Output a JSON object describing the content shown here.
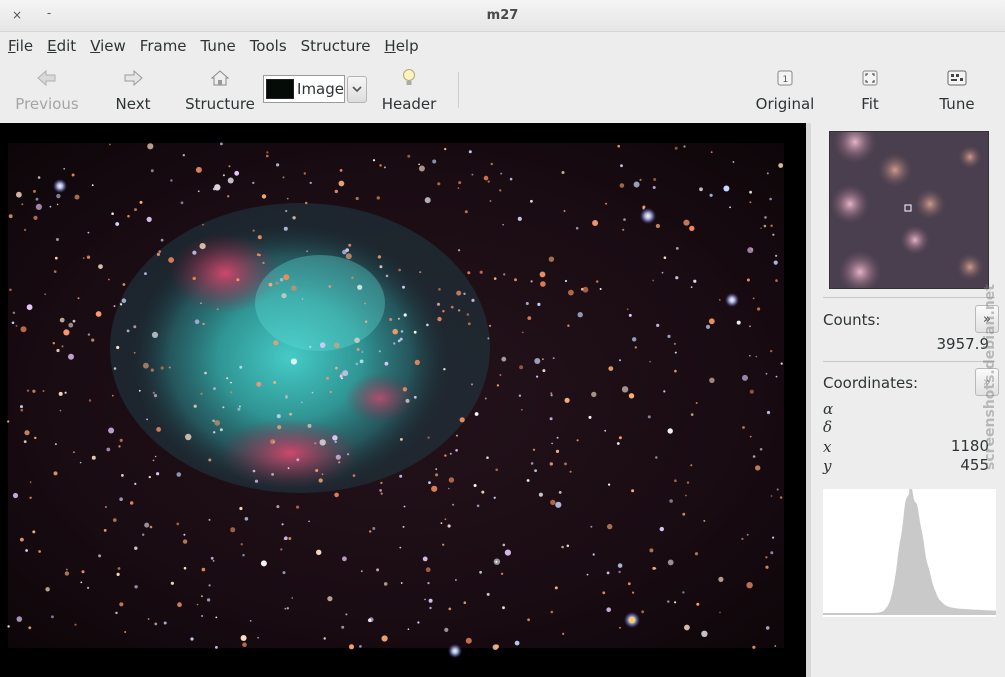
{
  "window": {
    "title": "m27",
    "close_glyph": "×",
    "minimize_glyph": "-"
  },
  "menu": [
    {
      "label": "File",
      "mnemonic": "F",
      "rest": "ile"
    },
    {
      "label": "Edit",
      "mnemonic": "E",
      "rest": "dit"
    },
    {
      "label": "View",
      "mnemonic": "V",
      "rest": "iew"
    },
    {
      "label": "Frame",
      "mnemonic": "",
      "rest": "Frame"
    },
    {
      "label": "Tune",
      "mnemonic": "",
      "rest": "Tune"
    },
    {
      "label": "Tools",
      "mnemonic": "",
      "rest": "Tools"
    },
    {
      "label": "Structure",
      "mnemonic": "",
      "rest": "Structure"
    },
    {
      "label": "Help",
      "mnemonic": "H",
      "rest": "elp"
    }
  ],
  "toolbar": {
    "previous_label": "Previous",
    "next_label": "Next",
    "structure_label": "Structure",
    "combo_value": "Image",
    "header_label": "Header",
    "original_label": "Original",
    "fit_label": "Fit",
    "tune_label": "Tune",
    "icons": {
      "previous": "arrow-left-icon",
      "next": "arrow-right-icon",
      "structure": "home-icon",
      "header": "lightbulb-icon",
      "original": "original-size-icon",
      "fit": "zoom-fit-icon",
      "tune": "tune-icon"
    }
  },
  "panel": {
    "counts_label": "Counts:",
    "counts_value": "3957.9",
    "coordinates_label": "Coordinates:",
    "alpha_symbol": "α",
    "delta_symbol": "δ",
    "x_symbol": "x",
    "y_symbol": "y",
    "alpha_value": "",
    "delta_value": "",
    "x_value": "1180",
    "y_value": "455",
    "expand_glyph": "»"
  },
  "watermark": "screenshots.debian.net",
  "colors": {
    "nebula_core": "#3fbfb8",
    "nebula_rim": "#d23a62",
    "sky": "#1a0e14"
  }
}
